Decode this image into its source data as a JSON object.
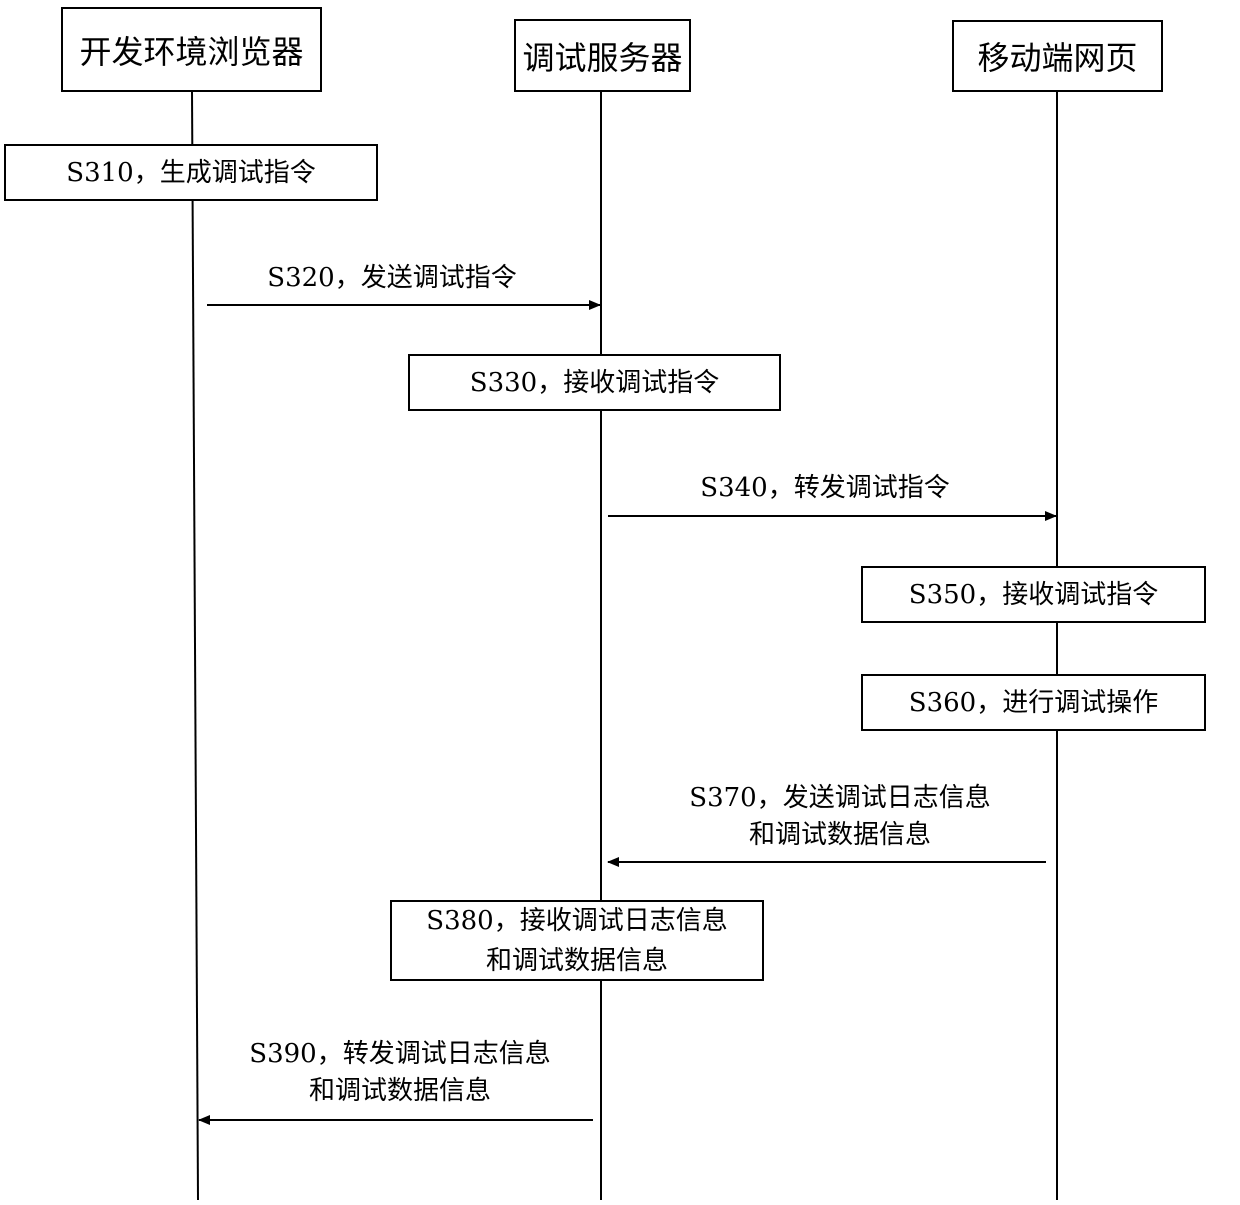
{
  "actors": [
    {
      "id": "dev-browser",
      "name": "开发环境浏览器"
    },
    {
      "id": "debug-server",
      "name": "调试服务器"
    },
    {
      "id": "mobile-page",
      "name": "移动端网页"
    }
  ],
  "steps": [
    {
      "id": "S310",
      "text": "S310，生成调试指令",
      "type": "activity",
      "actor": "dev-browser"
    },
    {
      "id": "S320",
      "text": "S320，发送调试指令",
      "type": "message",
      "from": "dev-browser",
      "to": "debug-server"
    },
    {
      "id": "S330",
      "text": "S330，接收调试指令",
      "type": "activity",
      "actor": "debug-server"
    },
    {
      "id": "S340",
      "text": "S340，转发调试指令",
      "type": "message",
      "from": "debug-server",
      "to": "mobile-page"
    },
    {
      "id": "S350",
      "text": "S350，接收调试指令",
      "type": "activity",
      "actor": "mobile-page"
    },
    {
      "id": "S360",
      "text": "S360，进行调试操作",
      "type": "activity",
      "actor": "mobile-page"
    },
    {
      "id": "S370",
      "text": "S370，发送调试日志信息",
      "text2": "和调试数据信息",
      "type": "message",
      "from": "mobile-page",
      "to": "debug-server"
    },
    {
      "id": "S380",
      "text": "S380，接收调试日志信息",
      "text2": "和调试数据信息",
      "type": "activity",
      "actor": "debug-server"
    },
    {
      "id": "S390",
      "text": "S390，转发调试日志信息",
      "text2": "和调试数据信息",
      "type": "message",
      "from": "debug-server",
      "to": "dev-browser"
    }
  ]
}
